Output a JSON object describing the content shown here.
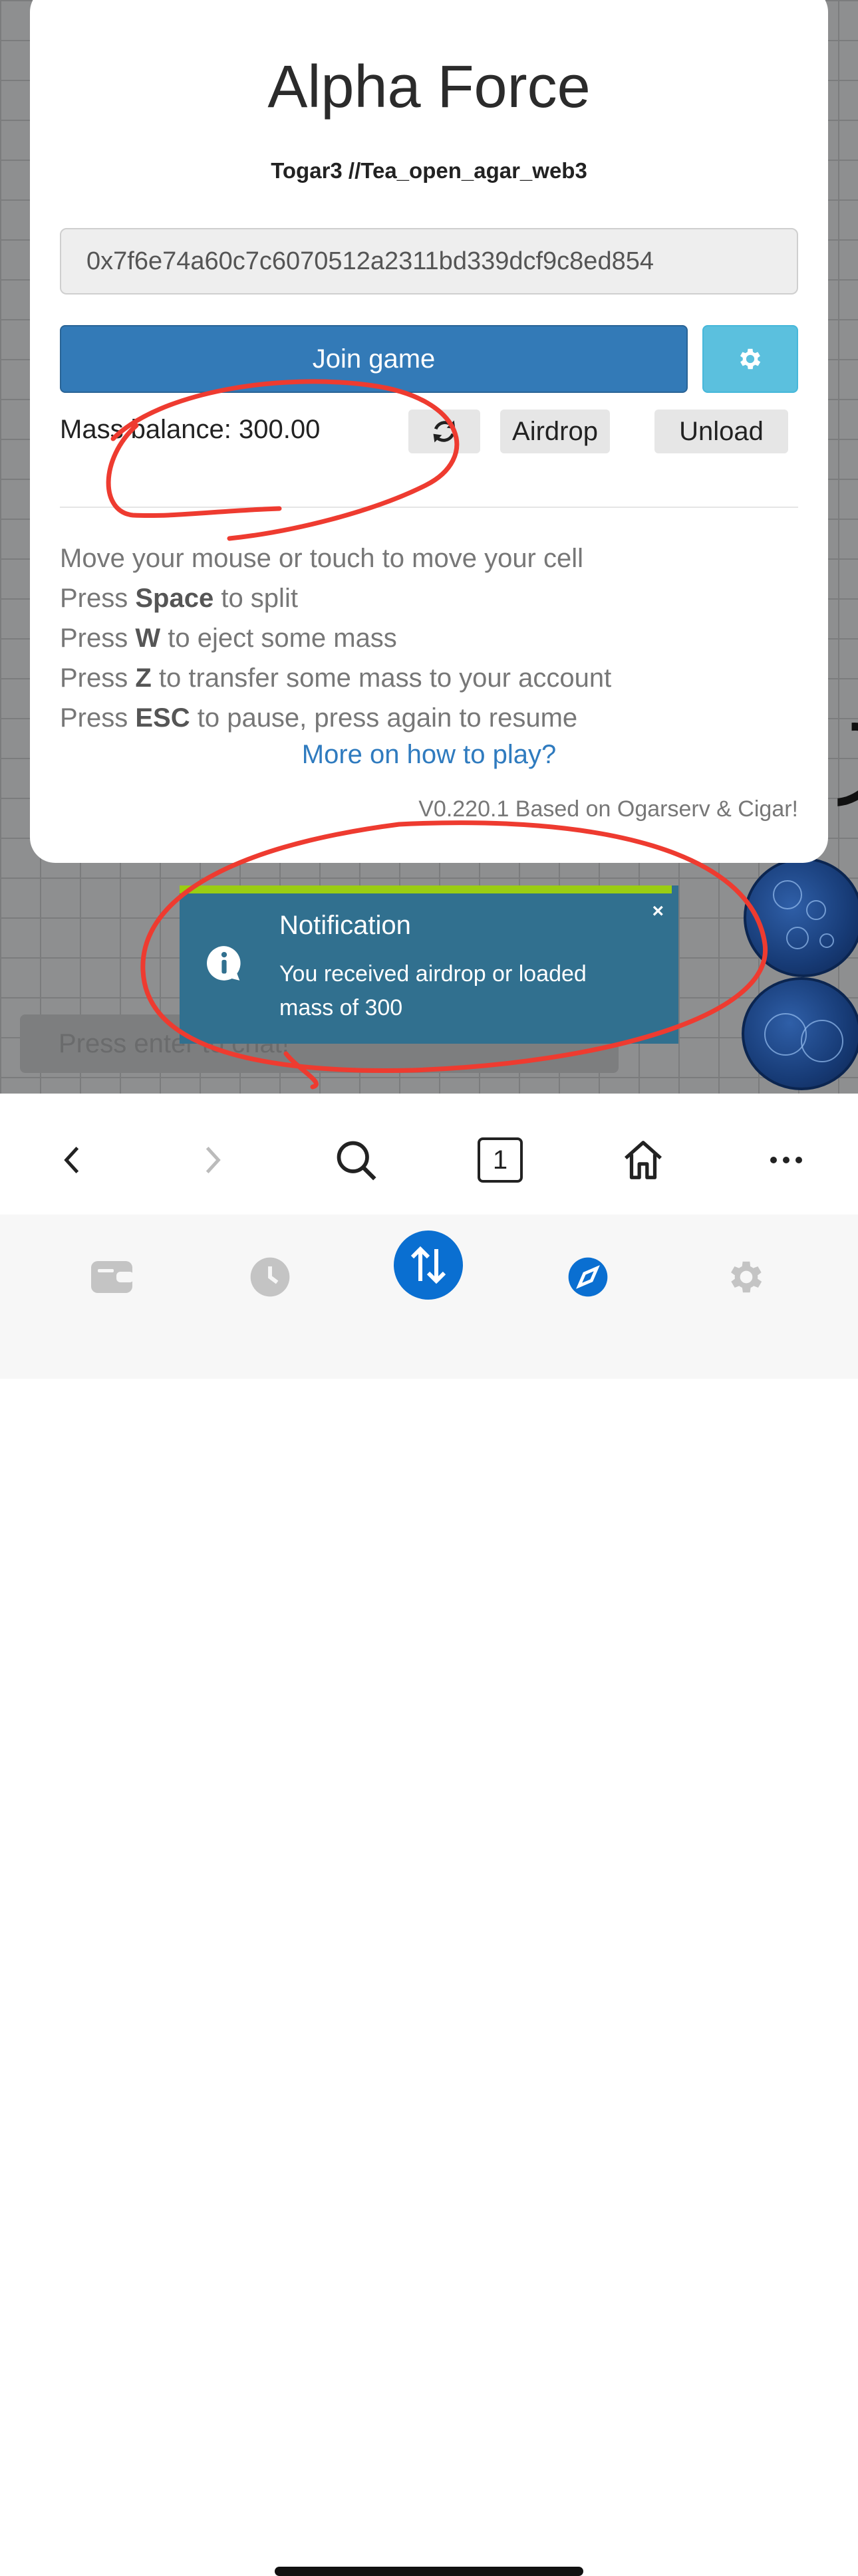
{
  "modal": {
    "title": "Alpha Force",
    "subtitle": "Togar3 //Tea_open_agar_web3",
    "address_value": "0x7f6e74a60c7c6070512a2311bd339dcf9c8ed854",
    "join_label": "Join game",
    "settings_icon": "gear-icon",
    "mass_label": "Mass balance: 300.00",
    "refresh_icon": "refresh-icon",
    "airdrop_label": "Airdrop",
    "unload_label": "Unload",
    "instructions": [
      {
        "pre": "Move your mouse or touch to move your cell",
        "key": "",
        "post": ""
      },
      {
        "pre": "Press ",
        "key": "Space",
        "post": " to split"
      },
      {
        "pre": "Press ",
        "key": "W",
        "post": " to eject some mass"
      },
      {
        "pre": "Press ",
        "key": "Z",
        "post": " to transfer some mass to your account"
      },
      {
        "pre": "Press ",
        "key": "ESC",
        "post": " to pause, press again to resume"
      }
    ],
    "howto_link": "More on how to play?",
    "version": "V0.220.1 Based on Ogarserv & Cigar!"
  },
  "game": {
    "chat_placeholder": "Press enter to chat!"
  },
  "notification": {
    "title": "Notification",
    "message": "You received airdrop or loaded mass of 300",
    "close": "×",
    "icon": "info-icon",
    "progress_color": "#9acd12",
    "bg_color": "#31708f"
  },
  "browser_toolbar": {
    "tab_count": "1",
    "icons": [
      "back-icon",
      "forward-icon",
      "search-icon",
      "tabs-icon",
      "home-icon",
      "more-icon"
    ]
  },
  "bottom_nav": {
    "icons": [
      "wallet-icon",
      "history-icon",
      "swap-icon",
      "browser-icon",
      "settings-icon"
    ],
    "active": "browser-icon",
    "accent": "#0a6fd1"
  },
  "colors": {
    "primary_button": "#337ab7",
    "info_button": "#5bc0de",
    "annotation_red": "#ee3b30"
  }
}
